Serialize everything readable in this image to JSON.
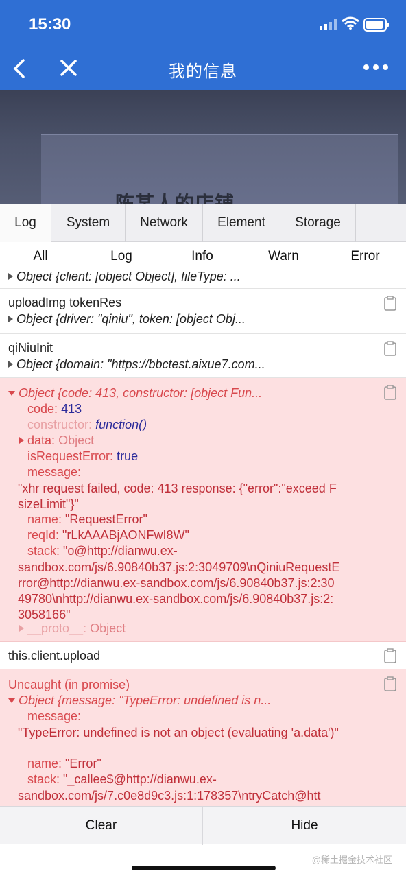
{
  "status_bar": {
    "time": "15:30"
  },
  "nav": {
    "title": "我的信息"
  },
  "background_page": {
    "shop_name": "陈某人的店铺"
  },
  "console": {
    "tabs": [
      "Log",
      "System",
      "Network",
      "Element",
      "Storage"
    ],
    "filters": [
      "All",
      "Log",
      "Info",
      "Warn",
      "Error"
    ],
    "entries": {
      "top_partial": "Object {client: [object Object], fileType: ...",
      "upload": {
        "label": "uploadImg tokenRes",
        "object": "Object {driver: \"qiniu\", token: [object Obj..."
      },
      "qiniu": {
        "label": "qiNiuInit",
        "object": "Object {domain: \"https://bbctest.aixue7.com..."
      },
      "request_error": {
        "header": "Object {code: 413, constructor: [object Fun...",
        "code_key": "code",
        "code_val": "413",
        "ctor_key": "constructor",
        "ctor_val": "function()",
        "data_key": "data",
        "data_val": "Object",
        "isreq_key": "isRequestError",
        "isreq_val": "true",
        "message_key": "message",
        "message_val": "\"xhr request failed, code: 413 response: {\"error\":\"exceed FsizeLimit\"}\"",
        "name_key": "name",
        "name_val": "\"RequestError\"",
        "reqid_key": "reqId",
        "reqid_val": "\"rLkAAABjAONFwI8W\"",
        "stack_key": "stack",
        "stack_val_first": "\"o@http://dianwu.ex-",
        "stack_val_rest": "sandbox.com/js/6.90840b37.js:2:3049709\\nQiniuRequestError@http://dianwu.ex-sandbox.com/js/6.90840b37.js:2:3049780\\nhttp://dianwu.ex-sandbox.com/js/6.90840b37.js:2:3058166\"",
        "proto_key": "__proto__",
        "proto_val": "Object"
      },
      "client_upload": {
        "label": "this.client.upload"
      },
      "uncaught": {
        "title": "Uncaught (in promise)",
        "header": "Object {message: \"TypeError: undefined is n...",
        "message_key": "message",
        "message_val": "\"TypeError: undefined is not an object (evaluating 'a.data')\"",
        "name_key": "name",
        "name_val": "\"Error\"",
        "stack_key": "stack",
        "stack_val_first": "\"_callee$@http://dianwu.ex-",
        "stack_val_rest": "sandbox.com/js/7.c0e8d9c3.js:1:178357\\ntryCatch@htt"
      }
    },
    "footer": {
      "clear": "Clear",
      "hide": "Hide"
    }
  },
  "watermark": "@稀土掘金技术社区",
  "colors": {
    "nav_blue": "#2f6fd4",
    "error_bg": "#fde0e1",
    "error_text": "#d8484d"
  }
}
